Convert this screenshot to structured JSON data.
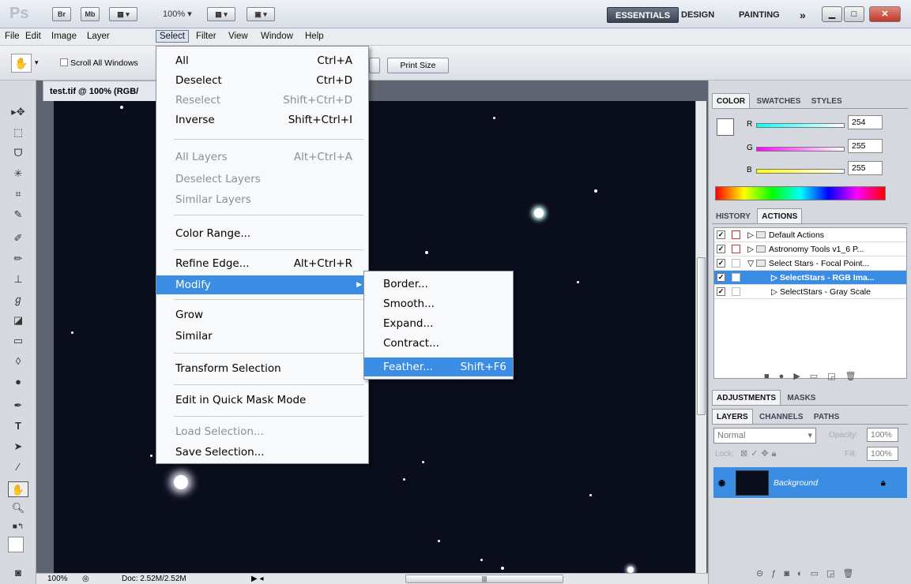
{
  "appbar": {
    "logo": "Ps",
    "bridge": "Br",
    "minibridge": "Mb",
    "zoom": "100%",
    "workspaces": [
      "ESSENTIALS",
      "DESIGN",
      "PAINTING"
    ],
    "more": "»"
  },
  "menubar": [
    "File",
    "Edit",
    "Image",
    "Layer",
    "Select",
    "Filter",
    "View",
    "Window",
    "Help"
  ],
  "options": {
    "scroll_all_label": "Scroll All Windows",
    "print_size_label": "Print Size"
  },
  "document": {
    "tab_title": "test.tif @ 100% (RGB/",
    "status_zoom": "100%",
    "status_doc": "Doc: 2.52M/2.52M"
  },
  "select_menu": {
    "items": [
      {
        "label": "All",
        "shortcut": "Ctrl+A"
      },
      {
        "label": "Deselect",
        "shortcut": "Ctrl+D"
      },
      {
        "label": "Reselect",
        "shortcut": "Shift+Ctrl+D"
      },
      {
        "label": "Inverse",
        "shortcut": "Shift+Ctrl+I"
      },
      {
        "label": "All Layers",
        "shortcut": "Alt+Ctrl+A"
      },
      {
        "label": "Deselect Layers",
        "shortcut": ""
      },
      {
        "label": "Similar Layers",
        "shortcut": ""
      },
      {
        "label": "Color Range...",
        "shortcut": ""
      },
      {
        "label": "Refine Edge...",
        "shortcut": "Alt+Ctrl+R"
      },
      {
        "label": "Modify",
        "shortcut": ""
      },
      {
        "label": "Grow",
        "shortcut": ""
      },
      {
        "label": "Similar",
        "shortcut": ""
      },
      {
        "label": "Transform Selection",
        "shortcut": ""
      },
      {
        "label": "Edit in Quick Mask Mode",
        "shortcut": ""
      },
      {
        "label": "Load Selection...",
        "shortcut": ""
      },
      {
        "label": "Save Selection...",
        "shortcut": ""
      }
    ]
  },
  "modify_menu": {
    "items": [
      {
        "label": "Border...",
        "shortcut": ""
      },
      {
        "label": "Smooth...",
        "shortcut": ""
      },
      {
        "label": "Expand...",
        "shortcut": ""
      },
      {
        "label": "Contract...",
        "shortcut": ""
      },
      {
        "label": "Feather...",
        "shortcut": "Shift+F6"
      }
    ]
  },
  "color_panel": {
    "tabs": [
      "COLOR",
      "SWATCHES",
      "STYLES"
    ],
    "r_label": "R",
    "g_label": "G",
    "b_label": "B",
    "r_value": "254",
    "g_value": "255",
    "b_value": "255"
  },
  "history_panel": {
    "tabs": [
      "HISTORY",
      "ACTIONS"
    ],
    "rows": [
      "Default Actions",
      "Astronomy Tools v1_6 P...",
      "Select Stars - Focal Point...",
      "SelectStars - RGB Ima...",
      "SelectStars - Gray Scale"
    ]
  },
  "adjust_panel": {
    "tabs": [
      "ADJUSTMENTS",
      "MASKS"
    ]
  },
  "layers_panel": {
    "tabs": [
      "LAYERS",
      "CHANNELS",
      "PATHS"
    ],
    "blend_mode": "Normal",
    "opacity_label": "Opacity:",
    "opacity_value": "100%",
    "lock_label": "Lock:",
    "fill_label": "Fill:",
    "fill_value": "100%",
    "layer_name": "Background"
  }
}
